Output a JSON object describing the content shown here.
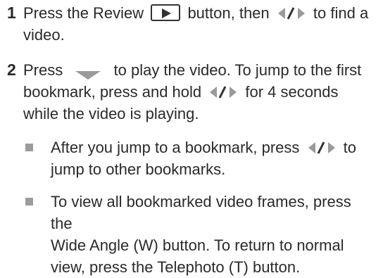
{
  "steps": [
    {
      "number": "1",
      "seg1": "Press the Review",
      "seg2": "button, then",
      "seg3": "to find a",
      "line2": "video."
    },
    {
      "number": "2",
      "seg1": "Press",
      "seg2": "to play the video. To jump to the first",
      "line2_a": "bookmark, press and hold",
      "line2_b": "for 4 seconds",
      "line3": "while the video is playing."
    }
  ],
  "bullets": [
    {
      "line1_a": "After you jump to a bookmark, press",
      "line1_b": "to",
      "line2": "jump to other bookmarks."
    },
    {
      "line1": "To view all bookmarked video frames, press the",
      "line2": "Wide Angle (W) button. To return to normal",
      "line3": "view, press the Telephoto (T) button."
    }
  ],
  "icons": {
    "review": "review-play-button-icon",
    "left_right": "left-right-arrows-icon",
    "down": "down-triangle-icon"
  },
  "colors": {
    "text": "#2a2a2a",
    "bullet": "#9c9c9c",
    "icon_gray": "#9a9a9a"
  }
}
